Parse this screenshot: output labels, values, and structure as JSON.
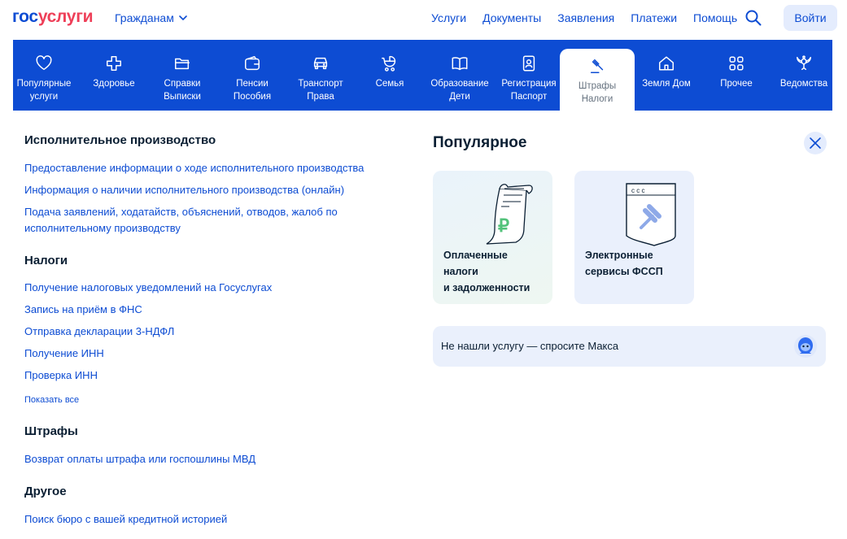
{
  "header": {
    "logo_part1": "гос",
    "logo_part2": "услуги",
    "role_label": "Гражданам",
    "nav": [
      "Услуги",
      "Документы",
      "Заявления",
      "Платежи",
      "Помощь"
    ],
    "login_label": "Войти"
  },
  "categories": [
    {
      "line1": "Популярные",
      "line2": "услуги",
      "icon": "heart-icon"
    },
    {
      "line1": "Здоровье",
      "line2": "",
      "icon": "medical-cross-icon"
    },
    {
      "line1": "Справки",
      "line2": "Выписки",
      "icon": "folder-icon"
    },
    {
      "line1": "Пенсии",
      "line2": "Пособия",
      "icon": "wallet-icon"
    },
    {
      "line1": "Транспорт",
      "line2": "Права",
      "icon": "car-icon"
    },
    {
      "line1": "Семья",
      "line2": "",
      "icon": "stroller-icon"
    },
    {
      "line1": "Образование",
      "line2": "Дети",
      "icon": "book-icon"
    },
    {
      "line1": "Регистрация",
      "line2": "Паспорт",
      "icon": "id-card-icon"
    },
    {
      "line1": "Штрафы",
      "line2": "Налоги",
      "icon": "gavel-icon",
      "active": true
    },
    {
      "line1": "Земля Дом",
      "line2": "",
      "icon": "house-icon"
    },
    {
      "line1": "Прочее",
      "line2": "",
      "icon": "grid-icon"
    },
    {
      "line1": "Ведомства",
      "line2": "",
      "icon": "emblem-icon"
    }
  ],
  "sections": {
    "enforcement": {
      "title": "Исполнительное производство",
      "links": [
        "Предоставление информации о ходе исполнительного производства",
        "Информация о наличии исполнительного производства (онлайн)",
        "Подача заявлений, ходатайств, объяснений, отводов, жалоб по",
        "исполнительному производству"
      ]
    },
    "taxes": {
      "title": "Налоги",
      "links": [
        "Получение налоговых уведомлений на Госуслугах",
        "Запись на приём в ФНС",
        "Отправка декларации 3-НДФЛ",
        "Получение ИНН",
        "Проверка ИНН"
      ],
      "show_all": "Показать все"
    },
    "fines": {
      "title": "Штрафы",
      "links": [
        "Возврат оплаты штрафа или госпошлины МВД"
      ]
    },
    "other": {
      "title": "Другое",
      "links": [
        "Поиск бюро с вашей кредитной историей"
      ]
    }
  },
  "popular": {
    "title": "Популярное",
    "cards": [
      {
        "text": "Оплаченные\nналоги\nи задолженности",
        "icon": "receipt-ruble-icon"
      },
      {
        "text": "Электронные\nсервисы ФССП",
        "icon": "fssp-gavel-icon"
      }
    ],
    "ask_max": "Не нашли услугу — спросите Макса"
  },
  "colors": {
    "brand_blue": "#0d4cd3",
    "brand_red": "#ee3f58",
    "text_dark": "#0b1f33",
    "light_blue_bg": "#e4ecfd"
  }
}
